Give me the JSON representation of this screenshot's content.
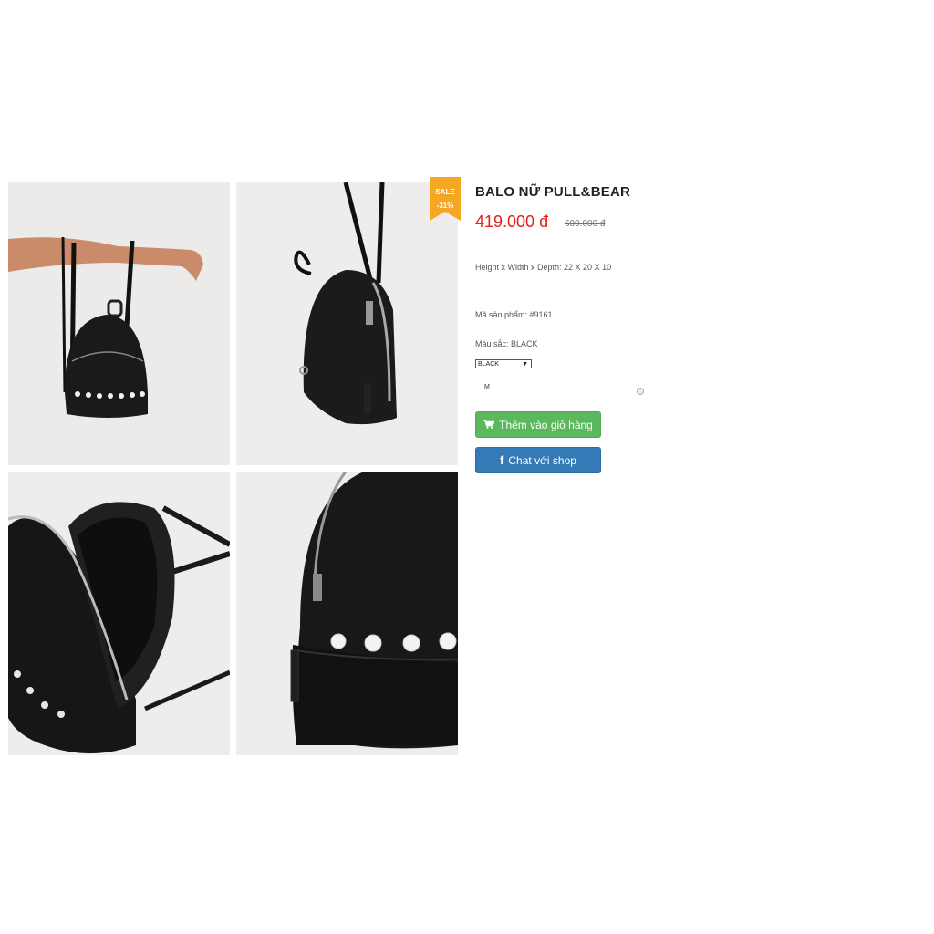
{
  "product": {
    "title": "BALO NỮ PULL&BEAR",
    "price": "419.000 đ",
    "old_price": "609.000 đ",
    "dimensions": "Height x Width x Depth: 22 X 20 X 10",
    "sku": "Mã sản phẩm: #9161",
    "color_label": "Màu sắc: BLACK",
    "color_select_value": "BLACK",
    "size": "M"
  },
  "badge": {
    "sale": "SALE",
    "discount": "-31%",
    "color": "#f5a623"
  },
  "buttons": {
    "add_to_cart": "Thêm vào giỏ hàng",
    "add_to_cart_icon": "cart-icon",
    "chat": "Chat với shop",
    "chat_icon": "facebook-icon"
  },
  "colors": {
    "price": "#e3201b",
    "cart_button": "#5cb85c",
    "chat_button": "#337ab7"
  }
}
